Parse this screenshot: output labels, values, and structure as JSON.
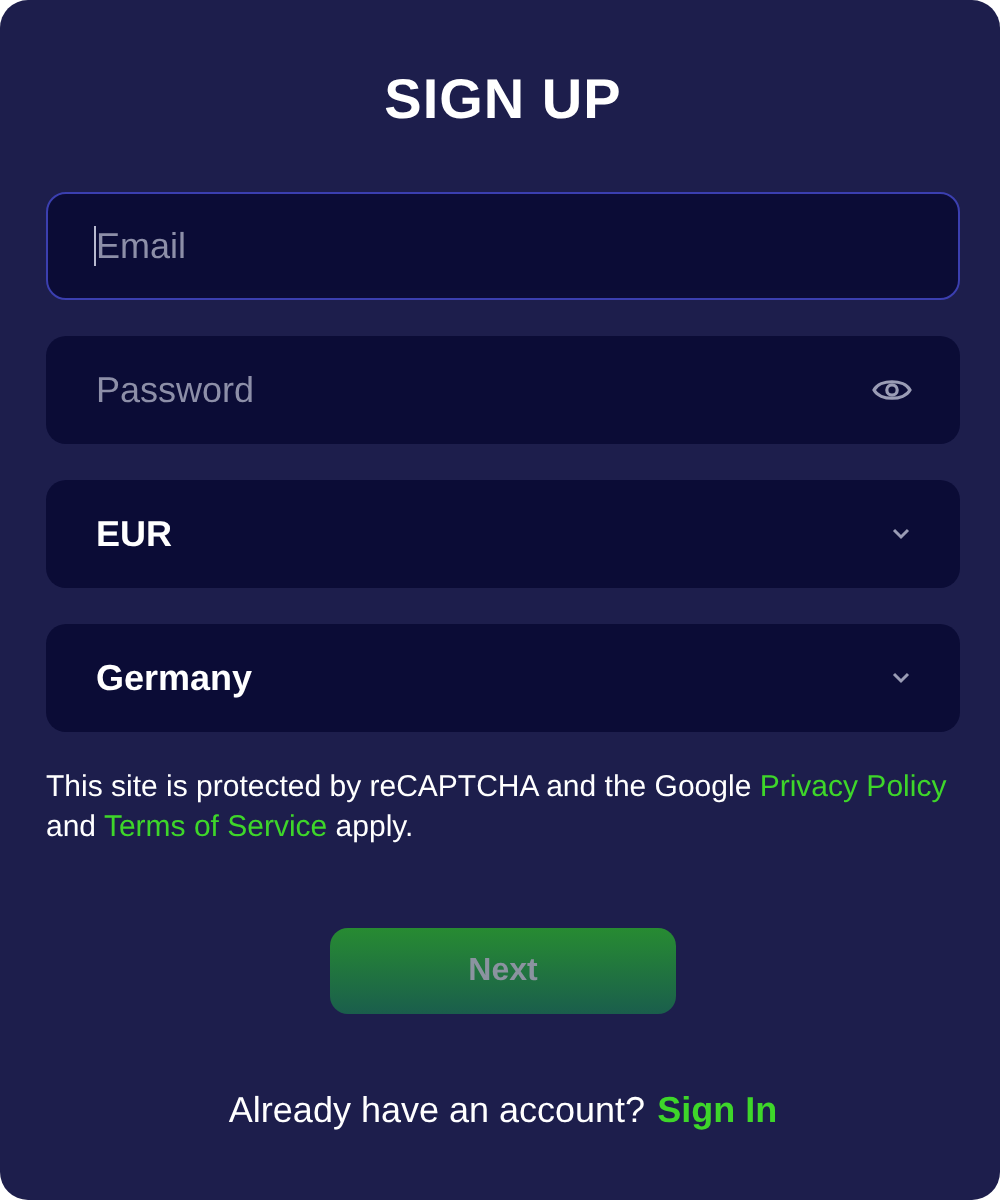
{
  "title": "SIGN UP",
  "fields": [
    {
      "kind": "text",
      "placeholder": "Email",
      "focused": true
    },
    {
      "kind": "password",
      "placeholder": "Password",
      "focused": false
    },
    {
      "kind": "select",
      "value": "EUR",
      "focused": false
    },
    {
      "kind": "select",
      "value": "Germany",
      "focused": false
    }
  ],
  "notice": [
    {
      "kind": "text",
      "text": "This site is protected by reCAPTCHA and the Google "
    },
    {
      "kind": "link",
      "text": "Privacy Policy"
    },
    {
      "kind": "text",
      "text": " and "
    },
    {
      "kind": "link",
      "text": "Terms of Service"
    },
    {
      "kind": "text",
      "text": " apply."
    }
  ],
  "next_button": {
    "label": "Next",
    "disabled": true
  },
  "footer": {
    "text": "Already have an account?",
    "link": "Sign In"
  }
}
